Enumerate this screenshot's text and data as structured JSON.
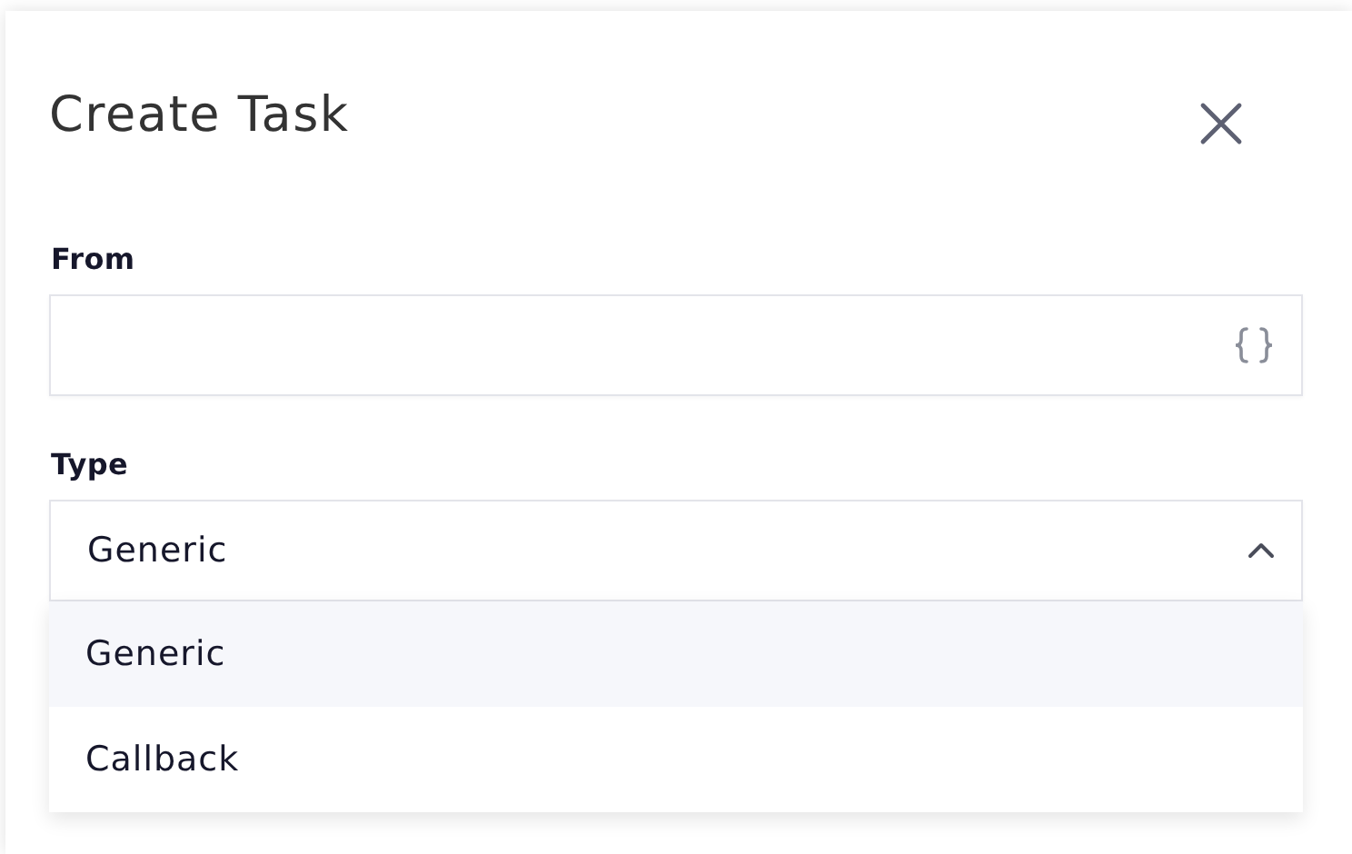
{
  "dialog": {
    "title": "Create Task",
    "fields": [
      {
        "kind": "text",
        "label": "From"
      },
      {
        "kind": "select",
        "label": "Type",
        "value": "Generic",
        "expanded": true,
        "options": [
          {
            "label": "Generic",
            "selected": true
          },
          {
            "label": "Callback",
            "selected": false
          }
        ]
      }
    ]
  }
}
